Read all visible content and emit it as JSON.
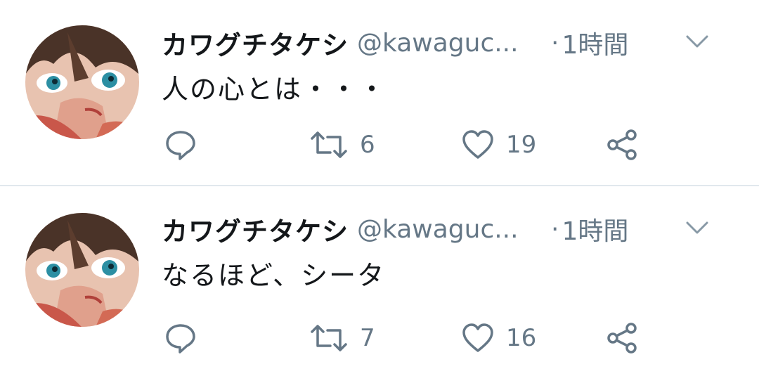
{
  "tweets": [
    {
      "display_name": "カワグチタケシ",
      "handle": "@kawaguc...",
      "separator": "·",
      "time": "1時間",
      "text": "人の心とは・・・",
      "retweets": "6",
      "likes": "19"
    },
    {
      "display_name": "カワグチタケシ",
      "handle": "@kawaguc...",
      "separator": "·",
      "time": "1時間",
      "text": "なるほど、シータ",
      "retweets": "7",
      "likes": "16"
    }
  ],
  "colors": {
    "text": "#14171a",
    "secondary": "#657786",
    "divider": "#e1e8ed"
  },
  "icons": [
    "reply-icon",
    "retweet-icon",
    "like-icon",
    "share-icon",
    "chevron-down-icon"
  ]
}
